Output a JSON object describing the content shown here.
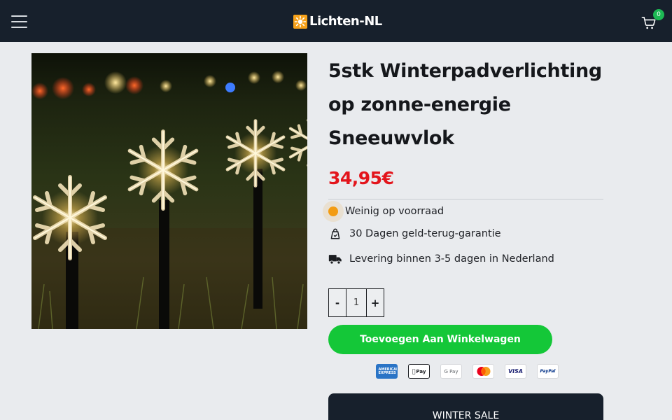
{
  "header": {
    "logo_text": "Lichten-NL",
    "cart_count": "0",
    "menu_icon": "hamburger-icon",
    "cart_icon": "shopping-cart-icon",
    "background": "#17202c"
  },
  "product": {
    "title": "5stk Winterpadverlichting op zonne-energie Sneeuwvlok",
    "price": "34,95€",
    "price_color": "#e3151c",
    "stock_label": "Weinig op voorraad",
    "stock_color": "#f39c12",
    "guarantee_label": "30 Dagen geld-terug-garantie",
    "delivery_label": "Levering binnen 3-5 dagen in Nederland",
    "quantity": {
      "minus_label": "-",
      "value": "1",
      "plus_label": "+"
    },
    "add_to_cart_label": "Toevoegen Aan Winkelwagen",
    "add_to_cart_color": "#14c738",
    "payment_methods": [
      {
        "name": "american-express",
        "label": "AMERICAN EXPRESS"
      },
      {
        "name": "apple-pay",
        "label": "Pay"
      },
      {
        "name": "google-pay",
        "label": "G Pay"
      },
      {
        "name": "mastercard",
        "label": ""
      },
      {
        "name": "visa",
        "label": "VISA"
      },
      {
        "name": "paypal",
        "label": "PayPal"
      }
    ]
  },
  "promo": {
    "label": "WINTER SALE"
  }
}
